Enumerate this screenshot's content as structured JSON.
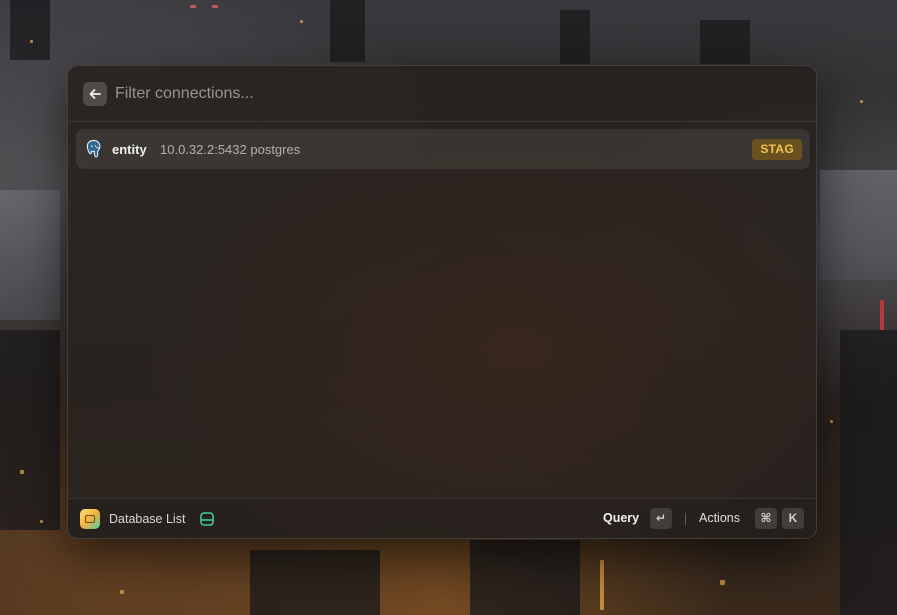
{
  "search": {
    "value": "",
    "placeholder": "Filter connections..."
  },
  "connections": [
    {
      "name": "entity",
      "subtitle": "10.0.32.2:5432 postgres",
      "environment": "STAG",
      "icon": "postgres-elephant-icon"
    }
  ],
  "footer": {
    "title": "Database List",
    "primary_action": "Query",
    "primary_shortcut": "↵",
    "secondary_action": "Actions",
    "secondary_shortcut_modifier": "⌘",
    "secondary_shortcut_key": "K"
  },
  "colors": {
    "accent_badge_bg": "#6a5220",
    "accent_badge_text": "#f1c24a",
    "db_icon": "#3fd39a",
    "postgres_icon": "#3a8fd6"
  }
}
